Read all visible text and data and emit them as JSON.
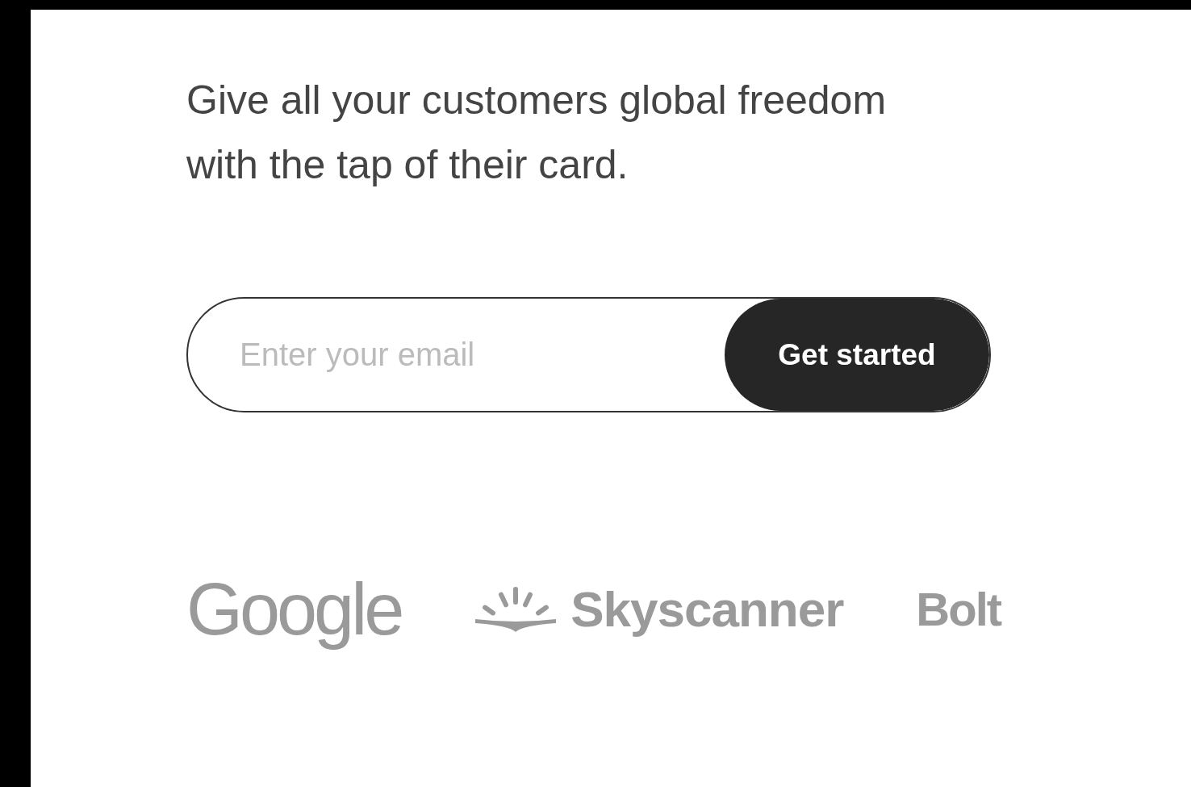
{
  "subtitle": "Give all your customers global freedom with the tap of their card.",
  "signup": {
    "placeholder": "Enter your email",
    "button": "Get started"
  },
  "logos": [
    {
      "kind": "wordmark",
      "text": "Google"
    },
    {
      "kind": "sunburst",
      "text": "Skyscanner"
    },
    {
      "kind": "bold",
      "text": "Bolt"
    }
  ]
}
